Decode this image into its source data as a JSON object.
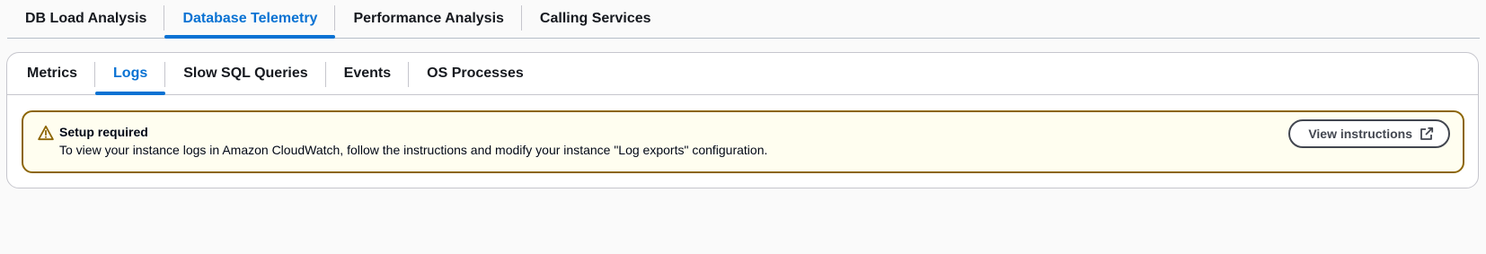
{
  "top_tabs": [
    {
      "label": "DB Load Analysis",
      "active": false
    },
    {
      "label": "Database Telemetry",
      "active": true
    },
    {
      "label": "Performance Analysis",
      "active": false
    },
    {
      "label": "Calling Services",
      "active": false
    }
  ],
  "inner_tabs": [
    {
      "label": "Metrics",
      "active": false
    },
    {
      "label": "Logs",
      "active": true
    },
    {
      "label": "Slow SQL Queries",
      "active": false
    },
    {
      "label": "Events",
      "active": false
    },
    {
      "label": "OS Processes",
      "active": false
    }
  ],
  "alert": {
    "type": "warning",
    "icon": "warning-icon",
    "title": "Setup required",
    "message": "To view your instance logs in Amazon CloudWatch, follow the instructions and modify your instance \"Log exports\" configuration.",
    "button_label": "View instructions",
    "button_icon": "external-link-icon"
  },
  "colors": {
    "accent": "#0972d3",
    "warning_border": "#8d6605",
    "warning_background": "#fffef0"
  }
}
